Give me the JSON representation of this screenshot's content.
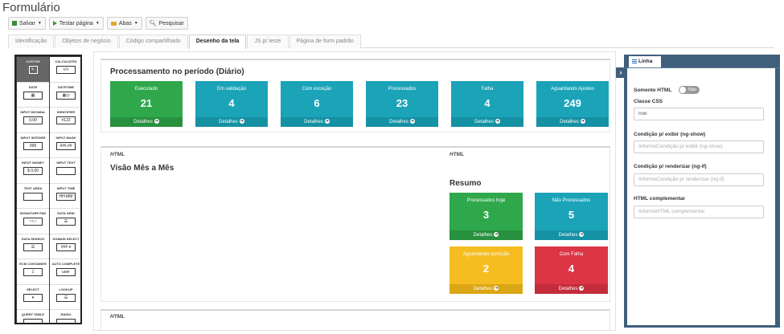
{
  "page": {
    "title": "Formulário"
  },
  "toolbar": {
    "save_label": "Salvar",
    "test_label": "Testar página",
    "tabs_label": "Abas",
    "search_label": "Pesquisar"
  },
  "tabs": [
    {
      "label": "Identificação",
      "active": false
    },
    {
      "label": "Objetos de negócio",
      "active": false
    },
    {
      "label": "Código compartilhado",
      "active": false
    },
    {
      "label": "Desenho da tela",
      "active": true
    },
    {
      "label": "JS p/ teste",
      "active": false
    },
    {
      "label": "Página de form padrão",
      "active": false
    }
  ],
  "palette": [
    {
      "label": "CUSTOM",
      "icon": "✎"
    },
    {
      "label": "CALCULATED",
      "icon": "</>"
    },
    {
      "label": "DATE",
      "icon": "▦"
    },
    {
      "label": "DATETIME",
      "icon": "▦◷"
    },
    {
      "label": "INPUT DECIMAL",
      "icon": "0,00"
    },
    {
      "label": "IDENTIFIER",
      "icon": "#123"
    },
    {
      "label": "INPUT INTEGER",
      "icon": "999"
    },
    {
      "label": "INPUT MASK",
      "icon": "###,##"
    },
    {
      "label": "INPUT MONEY",
      "icon": "$ 0,00"
    },
    {
      "label": "INPUT TEXT",
      "icon": ""
    },
    {
      "label": "TEXT AREA",
      "icon": ""
    },
    {
      "label": "INPUT TIME",
      "icon": "HH:MM"
    },
    {
      "label": "SIGNATURE PAD",
      "icon": "~∿~"
    },
    {
      "label": "DATA GRID",
      "icon": "☰"
    },
    {
      "label": "DATA SEARCH",
      "icon": "☰"
    },
    {
      "label": "DOMAIN SELECT",
      "icon": "### ▾"
    },
    {
      "label": "ECM CONTAINER",
      "icon": "⇩"
    },
    {
      "label": "AUTO COMPLETE",
      "icon": "user"
    },
    {
      "label": "SELECT",
      "icon": "▾"
    },
    {
      "label": "LOOKUP",
      "icon": "☰"
    },
    {
      "label": "QUERY TABLE",
      "icon": ""
    },
    {
      "label": "RADIO",
      "icon": ""
    }
  ],
  "canvas": {
    "section1": {
      "title": "Processamento no período (Diário)",
      "cards": [
        {
          "label": "Executado",
          "value": "21",
          "footer": "Detalhes",
          "color": "#2fa84c"
        },
        {
          "label": "Em validação",
          "value": "4",
          "footer": "Detalhes",
          "color": "#1ba3b8"
        },
        {
          "label": "Com exceção",
          "value": "6",
          "footer": "Detalhes",
          "color": "#1ba3b8"
        },
        {
          "label": "Processados",
          "value": "23",
          "footer": "Detalhes",
          "color": "#1ba3b8"
        },
        {
          "label": "Falha",
          "value": "4",
          "footer": "Detalhes",
          "color": "#1ba3b8"
        },
        {
          "label": "Aguardando Ajustes",
          "value": "249",
          "footer": "Detalhes",
          "color": "#1ba3b8"
        }
      ]
    },
    "section2": {
      "html_left": "HTML",
      "html_right": "HTML",
      "title": "Visão Mês a Mês",
      "summary_title": "Resumo",
      "cards": [
        {
          "label": "Processados hoje",
          "value": "3",
          "footer": "Detalhes",
          "color": "#2fa84c"
        },
        {
          "label": "Não Processados",
          "value": "5",
          "footer": "Detalhes",
          "color": "#1ba3b8"
        },
        {
          "label": "Aguardando correção",
          "value": "2",
          "footer": "Detalhes",
          "color": "#f5bd1f"
        },
        {
          "label": "Com Falha",
          "value": "4",
          "footer": "Detalhes",
          "color": "#dc3545"
        }
      ]
    },
    "section3": {
      "html_tag": "HTML"
    }
  },
  "properties": {
    "tab_label": "Linha",
    "only_html_label": "Somente HTML",
    "only_html_value": "Não",
    "css_class_label": "Classe CSS",
    "css_class_value": "row",
    "ng_show_label": "Condição p/ exibir (ng-show)",
    "ng_show_placeholder": "InformeCondição p/ exibir (ng-show)",
    "ng_if_label": "Condição p/ renderizar (ng-if)",
    "ng_if_placeholder": "InformeCondição p/ renderizar (ng-if)",
    "html_extra_label": "HTML complementar",
    "html_extra_placeholder": "InformeHTML complementar"
  }
}
